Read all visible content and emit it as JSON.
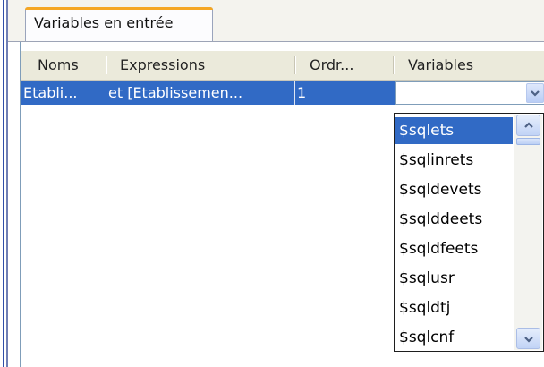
{
  "tab": {
    "label": "Variables en entrée"
  },
  "columns": [
    "Noms",
    "Expressions",
    "Ordr...",
    "Variables"
  ],
  "row": {
    "nom": "Etabli...",
    "expression": "et [Etablissemen...",
    "ordre": "1",
    "variable": ""
  },
  "dropdown": {
    "items": [
      "$sqlets",
      "$sqlinrets",
      "$sqldevets",
      "$sqlddeets",
      "$sqldfeets",
      "$sqlusr",
      "$sqldtj",
      "$sqlcnf"
    ],
    "selected": "$sqlets"
  },
  "colors": {
    "selection": "#316ac5",
    "header": "#ebeadb",
    "tab_accent": "#f5a623"
  }
}
